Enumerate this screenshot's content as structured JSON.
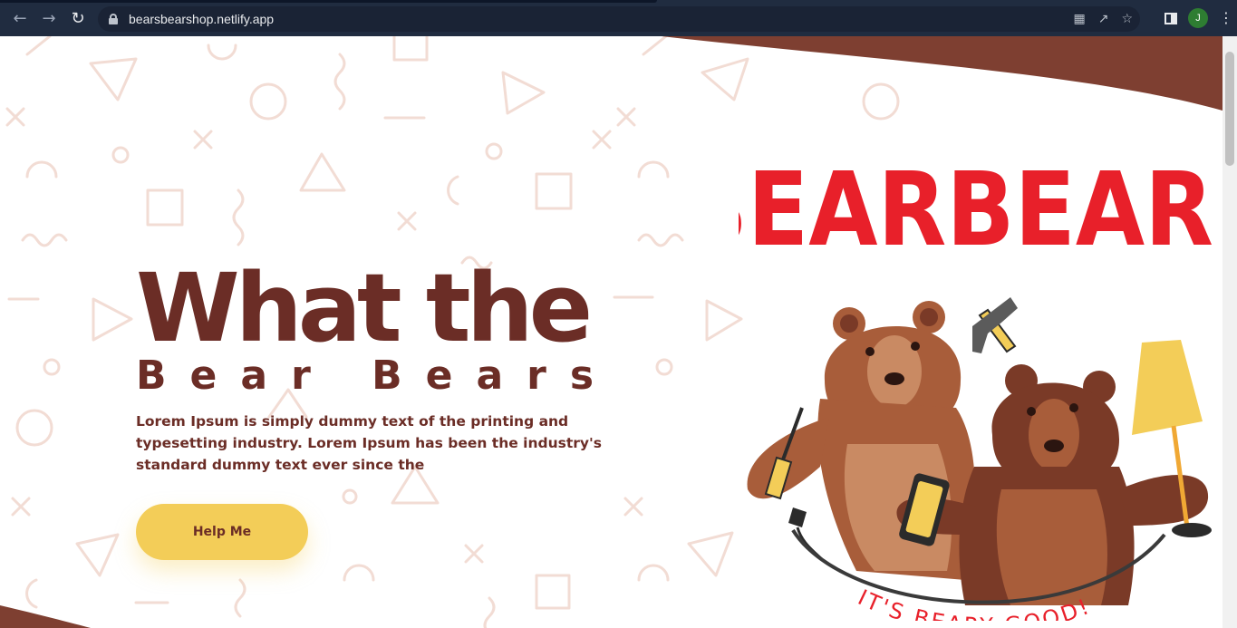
{
  "browser": {
    "url": "bearsbearshop.netlify.app",
    "avatar_letter": "J"
  },
  "hero": {
    "title": "What the",
    "subtitle": "Bear Bears",
    "body": "Lorem Ipsum is simply dummy text of the printing and typesetting industry. Lorem Ipsum has been the industry's standard dummy text ever since the",
    "cta_label": "Help Me"
  },
  "logo": {
    "wordmark": "BEARBEARS",
    "tagline": "IT'S BEARY GOOD!"
  },
  "colors": {
    "brand_brown": "#6b2d26",
    "wave_brown": "#7e3f31",
    "button_yellow": "#f3cd58",
    "logo_red": "#e8202a",
    "pattern_pink": "#f2dcd4",
    "chrome_bg": "#202c40"
  }
}
